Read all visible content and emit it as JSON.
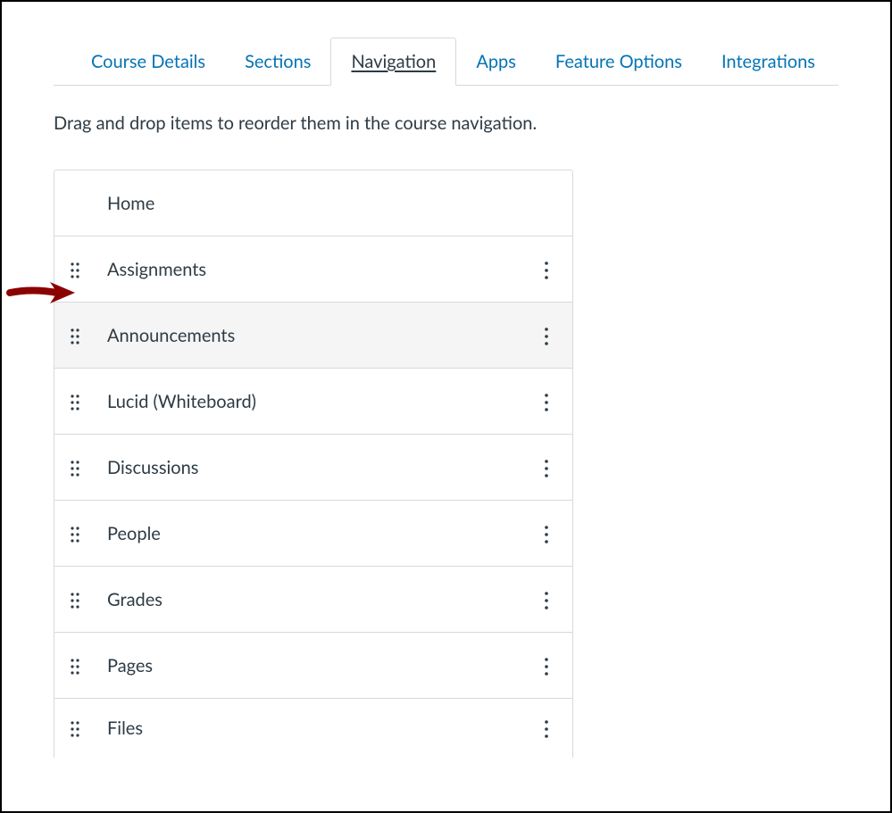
{
  "tabs": [
    {
      "id": "course-details",
      "label": "Course Details",
      "active": false
    },
    {
      "id": "sections",
      "label": "Sections",
      "active": false
    },
    {
      "id": "navigation",
      "label": "Navigation",
      "active": true
    },
    {
      "id": "apps",
      "label": "Apps",
      "active": false
    },
    {
      "id": "feature-options",
      "label": "Feature Options",
      "active": false
    },
    {
      "id": "integrations",
      "label": "Integrations",
      "active": false
    }
  ],
  "instruction": "Drag and drop items to reorder them in the course navigation.",
  "nav_items": [
    {
      "id": "home",
      "label": "Home",
      "has_handle": false,
      "has_menu": false,
      "hover": false,
      "last": false
    },
    {
      "id": "assignments",
      "label": "Assignments",
      "has_handle": true,
      "has_menu": true,
      "hover": false,
      "last": false
    },
    {
      "id": "announcements",
      "label": "Announcements",
      "has_handle": true,
      "has_menu": true,
      "hover": true,
      "last": false
    },
    {
      "id": "lucid",
      "label": "Lucid (Whiteboard)",
      "has_handle": true,
      "has_menu": true,
      "hover": false,
      "last": false
    },
    {
      "id": "discussions",
      "label": "Discussions",
      "has_handle": true,
      "has_menu": true,
      "hover": false,
      "last": false
    },
    {
      "id": "people",
      "label": "People",
      "has_handle": true,
      "has_menu": true,
      "hover": false,
      "last": false
    },
    {
      "id": "grades",
      "label": "Grades",
      "has_handle": true,
      "has_menu": true,
      "hover": false,
      "last": false
    },
    {
      "id": "pages",
      "label": "Pages",
      "has_handle": true,
      "has_menu": true,
      "hover": false,
      "last": false
    },
    {
      "id": "files",
      "label": "Files",
      "has_handle": true,
      "has_menu": true,
      "hover": false,
      "last": true
    }
  ],
  "colors": {
    "link": "#0374b5",
    "text": "#2d3b45",
    "border": "#d6d9dc",
    "annotation": "#8b0000"
  }
}
